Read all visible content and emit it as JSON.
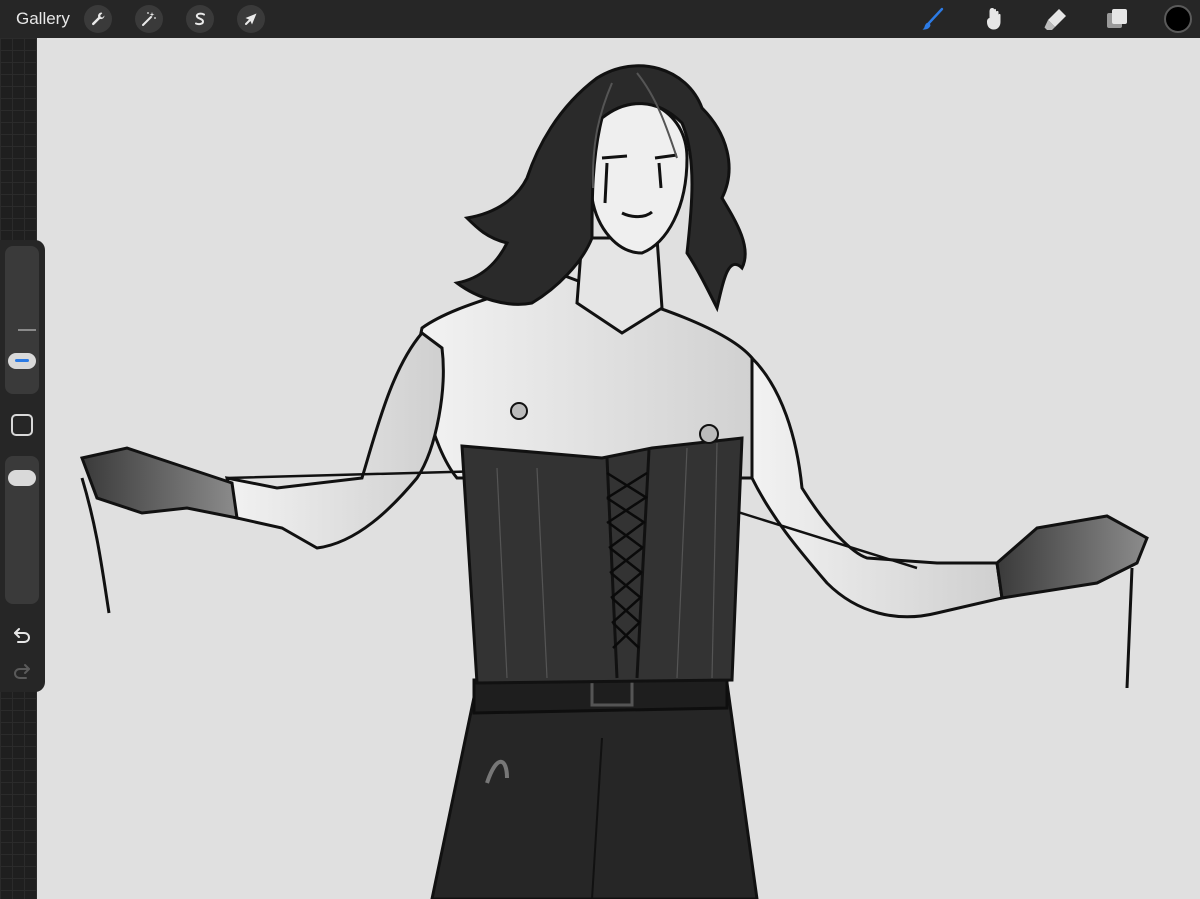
{
  "topbar": {
    "gallery_label": "Gallery",
    "left_tools": [
      {
        "name": "actions",
        "icon": "wrench-icon"
      },
      {
        "name": "adjustments",
        "icon": "magic-wand-icon"
      },
      {
        "name": "selection",
        "icon": "selection-s-icon"
      },
      {
        "name": "transform",
        "icon": "arrow-cursor-icon"
      }
    ],
    "right_tools": [
      {
        "name": "brush",
        "icon": "brush-icon",
        "active": true
      },
      {
        "name": "smudge",
        "icon": "smudge-icon",
        "active": false
      },
      {
        "name": "eraser",
        "icon": "eraser-icon",
        "active": false
      },
      {
        "name": "layers",
        "icon": "layers-icon",
        "active": false
      }
    ],
    "current_color": "#000000"
  },
  "sidebar": {
    "brush_size_icon": "brush-size-slider",
    "opacity_icon": "opacity-slider",
    "modify_button_icon": "square-outline-icon",
    "undo_icon": "undo-arrow-icon",
    "redo_icon": "redo-arrow-icon",
    "redo_enabled": false
  },
  "colors": {
    "accent": "#2c7be5",
    "toolbar_bg": "#262626",
    "canvas_bg": "#e0e0e0"
  }
}
